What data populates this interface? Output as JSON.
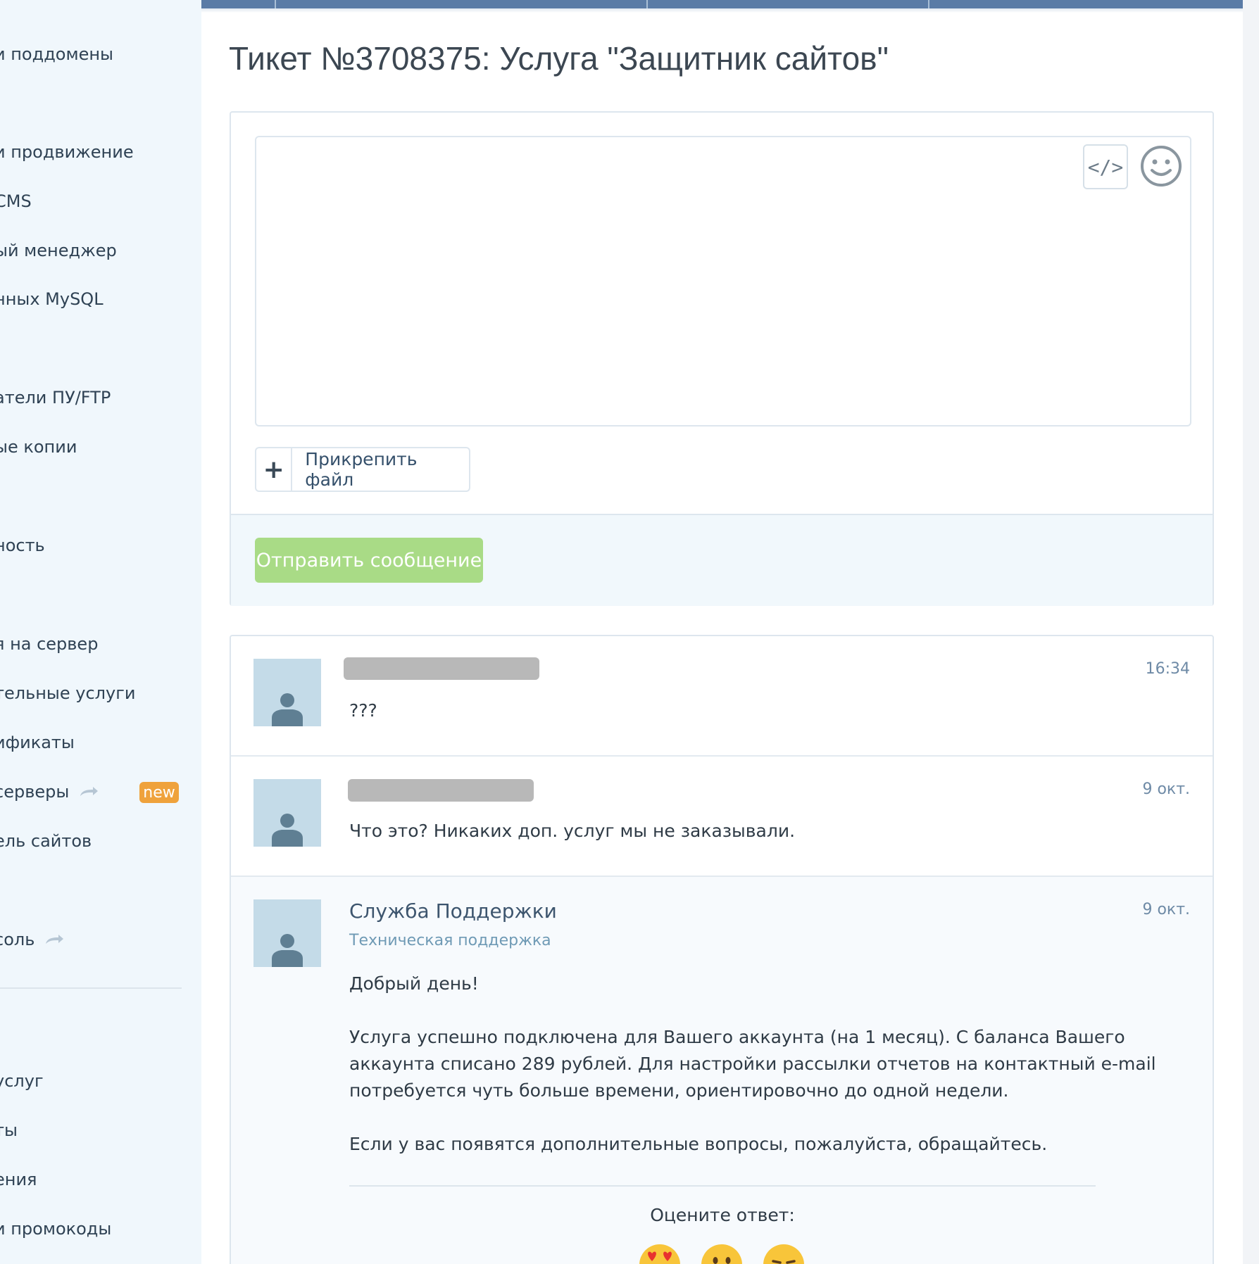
{
  "sidebar": {
    "items": [
      {
        "label": "и поддомены"
      },
      {
        "label": "и продвижение"
      },
      {
        "label": "CMS"
      },
      {
        "label": "ый менеджер"
      },
      {
        "label": "нных MySQL"
      },
      {
        "label": "атели ПУ/FTP"
      },
      {
        "label": "ые копии"
      },
      {
        "label": "ность"
      },
      {
        "label": "я на сервер"
      },
      {
        "label": "тельные услуги"
      },
      {
        "label": "ификаты"
      },
      {
        "label": " серверы"
      },
      {
        "label": "ель сайтов"
      },
      {
        "label": "соль"
      },
      {
        "label": "услуг"
      },
      {
        "label": "ты"
      },
      {
        "label": "ения"
      },
      {
        "label": "и промокоды"
      }
    ],
    "new_badge": "new"
  },
  "ticket": {
    "title": "Тикет №3708375: Услуга \"Защитник сайтов\""
  },
  "reply": {
    "code_button": "</>",
    "attach_label": "Прикрепить файл",
    "send_label": "Отправить сообщение"
  },
  "messages": [
    {
      "time": "16:34",
      "text": "???"
    },
    {
      "time": "9 окт.",
      "text": "Что это? Никаких доп. услуг мы не заказывали."
    },
    {
      "time": "9 окт.",
      "author": "Служба Поддержки",
      "role": "Техническая поддержка",
      "greeting": "Добрый день!",
      "paragraph1": "Услуга успешно подключена для Вашего аккаунта (на 1 месяц). С баланса Вашего аккаунта списано 289 рублей. Для настройки рассылки отчетов на контактный e-mail потребуется чуть больше времени, ориентировочно до одной недели.",
      "paragraph2": "Если у вас появятся дополнительные вопросы, пожалуйста, обращайтесь."
    }
  ],
  "rating": {
    "label": "Оцените ответ:",
    "options": [
      "heart-eyes-emoji-icon",
      "neutral-face-emoji-icon",
      "sad-face-emoji-icon"
    ]
  },
  "colors": {
    "send_button": "#a9db86",
    "badge_new": "#efa23c",
    "topbar": "#5a7ba6",
    "sidebar_bg": "#f0f7fc",
    "avatar_bg": "#c4dbe8"
  }
}
